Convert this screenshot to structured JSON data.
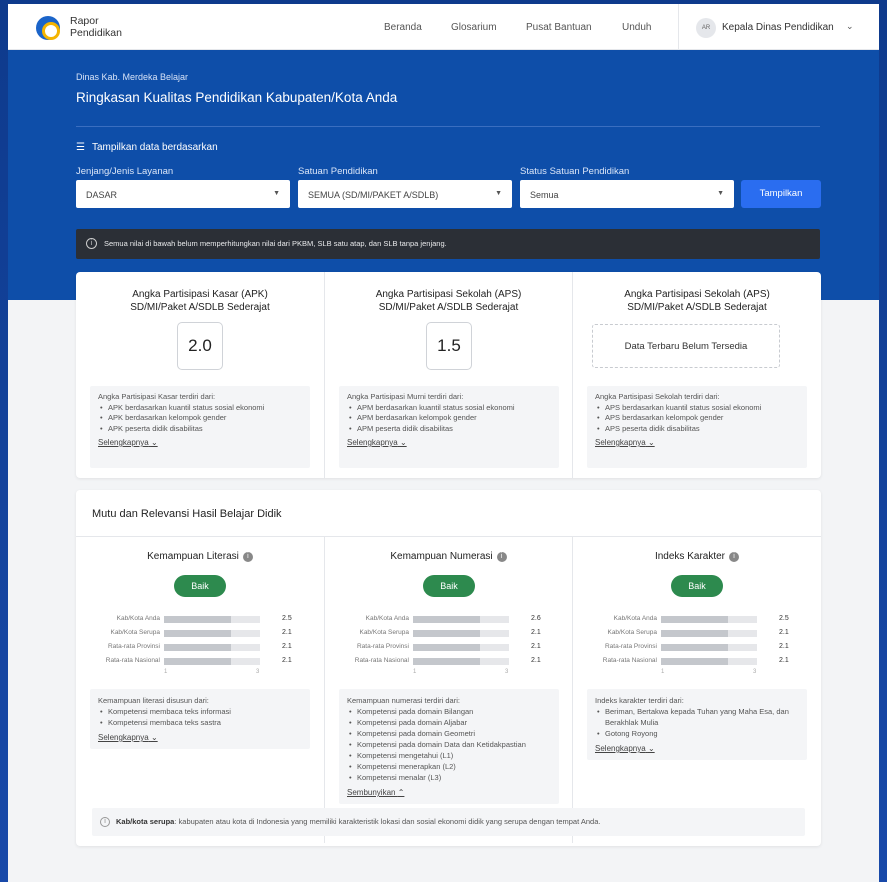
{
  "brand": {
    "line1": "Rapor",
    "line2": "Pendidikan"
  },
  "nav": {
    "items": [
      "Beranda",
      "Glosarium",
      "Pusat Bantuan",
      "Unduh"
    ]
  },
  "user": {
    "initials": "AR",
    "name": "Kepala Dinas Pendidikan"
  },
  "hero": {
    "subtitle": "Dinas Kab. Merdeka Belajar",
    "title": "Ringkasan Kualitas Pendidikan Kabupaten/Kota Anda"
  },
  "filters": {
    "heading": "Tampilkan data berdasarkan",
    "fields": [
      {
        "label": "Jenjang/Jenis Layanan",
        "value": "DASAR"
      },
      {
        "label": "Satuan Pendidikan",
        "value": "SEMUA (SD/MI/PAKET A/SDLB)"
      },
      {
        "label": "Status Satuan Pendidikan",
        "value": "Semua"
      }
    ],
    "button": "Tampilkan"
  },
  "notice": "Semua nilai di bawah belum memperhitungkan nilai dari PKBM, SLB satu atap, dan SLB tanpa jenjang.",
  "participation": [
    {
      "title1": "Angka Partisipasi Kasar (APK)",
      "title2": "SD/MI/Paket A/SDLB Sederajat",
      "value": "2.0",
      "desc_intro": "Angka Partisipasi Kasar terdiri dari:",
      "bullets": [
        "APK berdasarkan kuantil status sosial ekonomi",
        "APK berdasarkan kelompok gender",
        "APK peserta didik disabilitas"
      ],
      "more": "Selengkapnya"
    },
    {
      "title1": "Angka Partisipasi Sekolah (APS)",
      "title2": "SD/MI/Paket A/SDLB Sederajat",
      "value": "1.5",
      "desc_intro": "Angka Partisipasi Murni terdiri dari:",
      "bullets": [
        "APM berdasarkan kuantil status sosial ekonomi",
        "APM berdasarkan kelompok gender",
        "APM peserta didik disabilitas"
      ],
      "more": "Selengkapnya"
    },
    {
      "title1": "Angka Partisipasi Sekolah (APS)",
      "title2": "SD/MI/Paket A/SDLB Sederajat",
      "empty": "Data Terbaru Belum Tersedia",
      "desc_intro": "Angka Partisipasi Sekolah terdiri dari:",
      "bullets": [
        "APS berdasarkan kuantil status sosial ekonomi",
        "APS berdasarkan kelompok gender",
        "APS peserta didik disabilitas"
      ],
      "more": "Selengkapnya"
    }
  ],
  "mutu": {
    "title": "Mutu dan Relevansi Hasil Belajar Didik",
    "columns": [
      {
        "title": "Kemampuan Literasi",
        "badge": "Baik",
        "bars": [
          {
            "label": "Kab/Kota Anda",
            "value": "2.5",
            "fraction": 0.7
          },
          {
            "label": "Kab/Kota Serupa",
            "value": "2.1",
            "fraction": 0.7
          },
          {
            "label": "Rata-rata Provinsi",
            "value": "2.1",
            "fraction": 0.7
          },
          {
            "label": "Rata-rata Nasional",
            "value": "2.1",
            "fraction": 0.7
          }
        ],
        "ticks": [
          "1",
          "3"
        ],
        "desc_intro": "Kemampuan literasi disusun dari:",
        "bullets": [
          "Kompetensi membaca teks informasi",
          "Kompetensi membaca teks sastra"
        ],
        "toggle": "Selengkapnya",
        "toggle_icon": "⌄"
      },
      {
        "title": "Kemampuan Numerasi",
        "badge": "Baik",
        "bars": [
          {
            "label": "Kab/Kota Anda",
            "value": "2.6",
            "fraction": 0.7
          },
          {
            "label": "Kab/Kota Serupa",
            "value": "2.1",
            "fraction": 0.7
          },
          {
            "label": "Rata-rata Provinsi",
            "value": "2.1",
            "fraction": 0.7
          },
          {
            "label": "Rata-rata Nasional",
            "value": "2.1",
            "fraction": 0.7
          }
        ],
        "ticks": [
          "1",
          "3"
        ],
        "desc_intro": "Kemampuan numerasi terdiri dari:",
        "bullets": [
          "Kompetensi pada domain Bilangan",
          "Kompetensi pada domain Aljabar",
          "Kompetensi pada domain Geometri",
          "Kompetensi pada domain Data dan Ketidakpastian",
          "Kompetensi mengetahui (L1)",
          "Kompetensi menerapkan (L2)",
          "Kompetensi menalar (L3)"
        ],
        "toggle": "Sembunyikan",
        "toggle_icon": "⌃"
      },
      {
        "title": "Indeks Karakter",
        "badge": "Baik",
        "bars": [
          {
            "label": "Kab/Kota Anda",
            "value": "2.5",
            "fraction": 0.7
          },
          {
            "label": "Kab/Kota Serupa",
            "value": "2.1",
            "fraction": 0.7
          },
          {
            "label": "Rata-rata Provinsi",
            "value": "2.1",
            "fraction": 0.7
          },
          {
            "label": "Rata-rata Nasional",
            "value": "2.1",
            "fraction": 0.7
          }
        ],
        "ticks": [
          "1",
          "3"
        ],
        "desc_intro": "Indeks karakter terdiri dari:",
        "bullets": [
          "Beriman, Bertakwa kepada Tuhan yang Maha Esa, dan Berakhlak Mulia",
          "Gotong Royong"
        ],
        "toggle": "Selengkapnya",
        "toggle_icon": "⌄"
      }
    ],
    "footnote_term": "Kab/kota serupa",
    "footnote_text": ": kabupaten atau kota di Indonesia yang memiliki karakteristik lokasi dan sosial ekonomi didik yang serupa dengan tempat Anda."
  }
}
